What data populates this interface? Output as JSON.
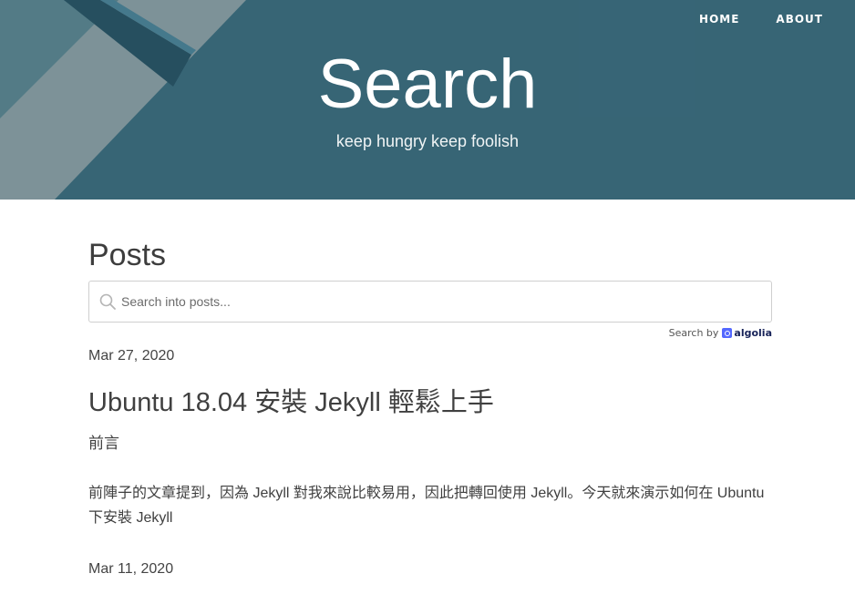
{
  "nav": {
    "home": "HOME",
    "about": "ABOUT"
  },
  "hero": {
    "title": "Search",
    "subtitle": "keep hungry keep foolish"
  },
  "main": {
    "section_title": "Posts",
    "search": {
      "placeholder": "Search into posts...",
      "value": ""
    },
    "search_by": {
      "label": "Search by",
      "brand": "algolia"
    },
    "posts": [
      {
        "date": "Mar 27, 2020",
        "title": "Ubuntu 18.04 安裝 Jekyll 輕鬆上手",
        "section": "前言",
        "excerpt": "前陣子的文章提到，因為 Jekyll 對我來說比較易用，因此把轉回使用 Jekyll。今天就來演示如何在 Ubuntu 下安裝 Jekyll"
      },
      {
        "date": "Mar 11, 2020"
      }
    ]
  },
  "colors": {
    "hero_background": "#3f7386",
    "algolia_brand": "#5468ff",
    "text": "#404040"
  },
  "icons": {
    "search": "search-icon",
    "algolia": "algolia-icon"
  }
}
